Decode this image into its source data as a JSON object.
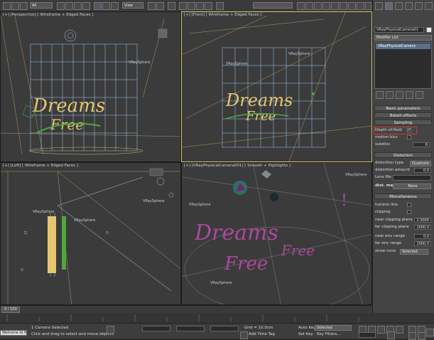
{
  "toolbar": {
    "filter_select": "All",
    "view_select": "View"
  },
  "viewports": {
    "perspective": {
      "label": "[+] [Perspective] [ Wireframe + Edged Faces ]",
      "light_label": "VRaySphere"
    },
    "front": {
      "label": "[+] [Front] [ Wireframe + Edged Faces ]",
      "light_label_1": "VRaySphere",
      "light_label_2": "VRaySphere"
    },
    "left": {
      "label": "[+] [Left] [ Wireframe + Edged Faces ]",
      "light_label_1": "VRaySphere",
      "light_label_2": "VRaySphere",
      "light_label_3": "VRaySphere"
    },
    "camera": {
      "label": "[+] [VRayPhysicalCamera001] [ Smooth + Highlights ]",
      "light_label_1": "VRaySphere",
      "light_label_2": "VRaySphere",
      "light_label_3": "VRaySphere"
    }
  },
  "panel": {
    "object_name": "VRayPhysicalCamera01",
    "modifier_list": "Modifier List",
    "stack_item": "VRayPhysicalCamera",
    "rollouts": {
      "basic": "Basic parameters",
      "bokeh": "Bokeh effects",
      "sampling": "Sampling",
      "distortion": "Distortion",
      "misc": "Miscellaneous"
    },
    "sampling": {
      "dof_label": "Depth-of-field",
      "motion_blur_label": "motion blur",
      "subdivs_label": "subdivs",
      "subdivs_value": "6"
    },
    "distortion": {
      "type_label": "distortion type",
      "type_value": "Quadratic",
      "amount_label": "distortion amount",
      "amount_value": "0.0",
      "lens_file_label": "Lens file",
      "dist_map_label": "dist. map",
      "dist_map_value": "None"
    },
    "misc": {
      "horizon_label": "horizon line",
      "clipping_label": "clipping",
      "near_clip_label": "near clipping plane",
      "near_clip_value": "2.3000",
      "far_clip_label": "far clipping plane",
      "far_clip_value": "1000.0",
      "near_env_label": "near env range",
      "near_env_value": "0.0",
      "far_env_label": "far env range",
      "far_env_value": "1000.0",
      "show_cone_label": "show cone",
      "show_cone_value": "Selected"
    }
  },
  "timeline": {
    "frame_display": "0 / 100"
  },
  "status": {
    "script_box": "Welcome to M",
    "selection_text": "1 Camera Selected",
    "prompt_text": "Click and drag to select and move objects",
    "grid_text": "Grid = 10.0cm",
    "add_time_tag": "Add Time Tag",
    "auto_key": "Auto Key",
    "selected_dropdown": "Selected",
    "set_key": "Set Key",
    "key_filters": "Key Filters..."
  },
  "colors": {
    "viewport_bg": "#3b3b3b",
    "active_border": "#d8c468",
    "text_gold": "#e6c770",
    "text_green": "#4fa83a",
    "text_magenta": "#a84a9c",
    "grid_blue": "#9fd0ff"
  }
}
